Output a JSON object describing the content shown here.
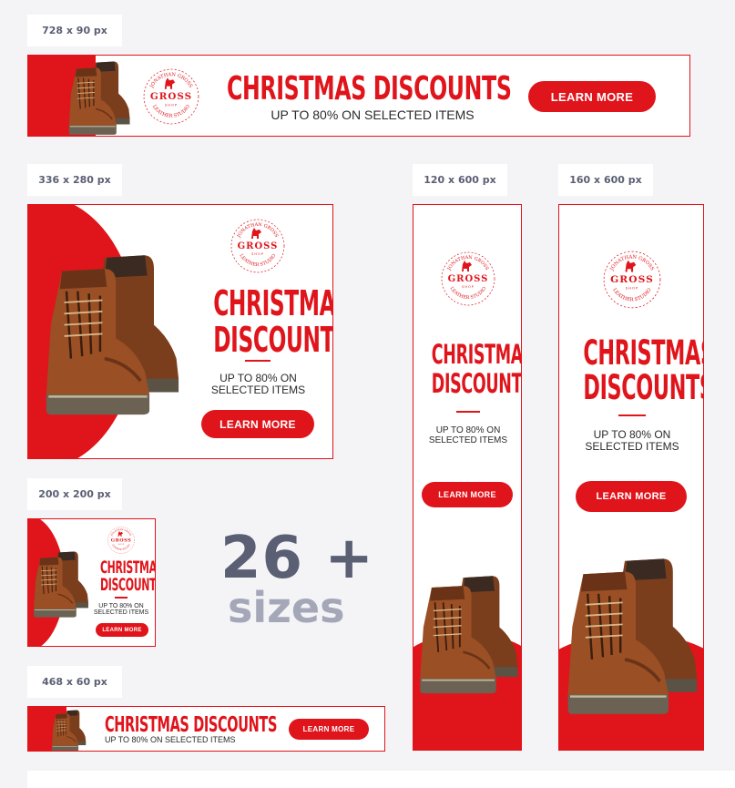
{
  "sizes": {
    "s728": "728 x 90 px",
    "s336": "336 x 280 px",
    "s120": "120 x 600 px",
    "s160": "160 x 600 px",
    "s200": "200 x 200 px",
    "s468": "468 x 60 px"
  },
  "ad": {
    "headline": "CHRISTMAS DISCOUNTS",
    "headline_line1": "CHRISTMAS",
    "headline_line2": "DISCOUNTS",
    "subline": "UP TO 80% ON SELECTED ITEMS",
    "subline_line1": "UP TO 80% ON",
    "subline_line2": "SELECTED ITEMS",
    "cta": "LEARN MORE"
  },
  "logo": {
    "top_arc": "JONATHAN GROSS",
    "brand": "GROSS",
    "shop": "SHOP",
    "bottom_arc": "LEATHER STUDIO"
  },
  "promo": {
    "number": "26 +",
    "word": "sizes"
  },
  "colors": {
    "accent": "#e0141b",
    "text_dark": "#2a2a2a",
    "slate": "#5a5f73",
    "slate_light": "#a3a7b8"
  }
}
